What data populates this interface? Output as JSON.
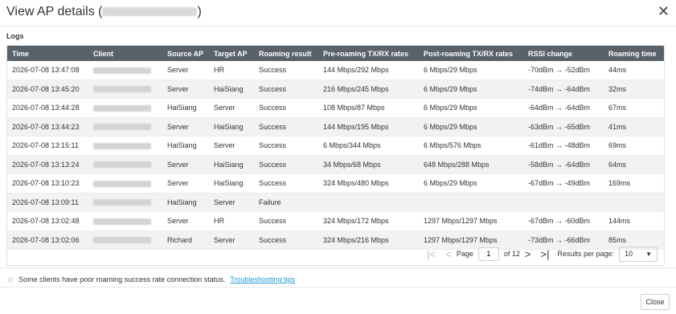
{
  "dialog": {
    "title_prefix": "View AP details (",
    "title_suffix": ")",
    "close_icon": "close-icon"
  },
  "logs": {
    "label": "Logs",
    "columns": [
      "Time",
      "Client",
      "Source AP",
      "Target AP",
      "Roaming result",
      "Pre-roaming TX/RX rates",
      "Post-roaming TX/RX rates",
      "RSSI change",
      "Roaming time"
    ],
    "rows": [
      [
        "2026-07-08 13:47:08",
        "",
        "Server",
        "HR",
        "Success",
        "144 Mbps/292 Mbps",
        "6 Mbps/29 Mbps",
        "-70dBm → -52dBm",
        "44ms"
      ],
      [
        "2026-07-08 13:45:20",
        "",
        "Server",
        "HaiSiang",
        "Success",
        "216 Mbps/245 Mbps",
        "6 Mbps/29 Mbps",
        "-74dBm → -64dBm",
        "32ms"
      ],
      [
        "2026-07-08 13:44:28",
        "",
        "HaiSiang",
        "Server",
        "Success",
        "108 Mbps/87 Mbps",
        "6 Mbps/29 Mbps",
        "-64dBm → -64dBm",
        "67ms"
      ],
      [
        "2026-07-08 13:44:23",
        "",
        "Server",
        "HaiSiang",
        "Success",
        "144 Mbps/195 Mbps",
        "6 Mbps/29 Mbps",
        "-63dBm → -65dBm",
        "41ms"
      ],
      [
        "2026-07-08 13:15:11",
        "",
        "HaiSiang",
        "Server",
        "Success",
        "6 Mbps/344 Mbps",
        "6 Mbps/576 Mbps",
        "-61dBm → -48dBm",
        "69ms"
      ],
      [
        "2026-07-08 13:13:24",
        "",
        "Server",
        "HaiSiang",
        "Success",
        "34 Mbps/68 Mbps",
        "648 Mbps/288 Mbps",
        "-58dBm → -64dBm",
        "64ms"
      ],
      [
        "2026-07-08 13:10:23",
        "",
        "Server",
        "HaiSiang",
        "Success",
        "324 Mbps/480 Mbps",
        "6 Mbps/29 Mbps",
        "-67dBm → -49dBm",
        "169ms"
      ],
      [
        "2026-07-08 13:09:11",
        "",
        "HaiSiang",
        "Server",
        "Failure",
        "",
        "",
        "",
        ""
      ],
      [
        "2026-07-08 13:02:48",
        "",
        "Server",
        "HR",
        "Success",
        "324 Mbps/172 Mbps",
        "1297 Mbps/1297 Mbps",
        "-67dBm → -60dBm",
        "144ms"
      ],
      [
        "2026-07-08 13:02:06",
        "",
        "Richard",
        "Server",
        "Success",
        "324 Mbps/216 Mbps",
        "1297 Mbps/1297 Mbps",
        "-73dBm → -66dBm",
        "85ms"
      ]
    ]
  },
  "pagination": {
    "page_label": "Page",
    "page_value": "1",
    "of_label": "of 12",
    "rpp_label": "Results per page:",
    "rpp_value": "10",
    "icons": [
      "first-page-icon",
      "prev-page-icon",
      "next-page-icon",
      "last-page-icon",
      "chevron-down-icon"
    ]
  },
  "tip": {
    "icon": "lightbulb-icon",
    "text": "Some clients have poor roaming success rate connection status.",
    "link": "Troubleshooting tips"
  },
  "footer": {
    "close_label": "Close"
  }
}
